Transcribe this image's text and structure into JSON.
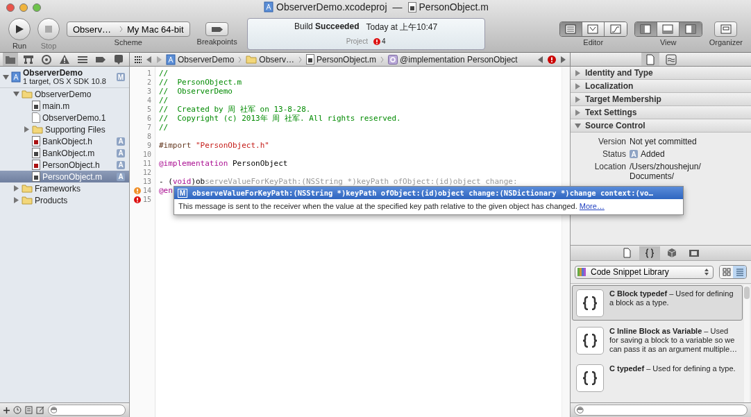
{
  "window": {
    "project_title": "ObserverDemo.xcodeproj",
    "separator": "—",
    "file_title": "PersonObject.m"
  },
  "toolbar": {
    "run": {
      "label": "Run",
      "disabled": false
    },
    "stop": {
      "label": "Stop",
      "disabled": true
    },
    "scheme": {
      "target": "Observ…",
      "destination": "My Mac 64-bit",
      "label": "Scheme"
    },
    "breakpoints": {
      "label": "Breakpoints"
    },
    "activity": {
      "status": "Build **Succeeded**",
      "time": "Today at 上午10:47",
      "scope": "Project",
      "issue_count": "4"
    },
    "editor_modes": {
      "label": "Editor",
      "buttons": [
        {
          "kind": "standard",
          "selected": true
        },
        {
          "kind": "assistant",
          "selected": false
        },
        {
          "kind": "version",
          "selected": false
        }
      ]
    },
    "view_toggles": {
      "label": "View",
      "buttons": [
        {
          "kind": "navigator",
          "on": true
        },
        {
          "kind": "debug",
          "on": false
        },
        {
          "kind": "utilities",
          "on": true
        }
      ]
    },
    "organizer": {
      "label": "Organizer"
    }
  },
  "navigator_tabs": [
    {
      "kind": "project",
      "selected": true
    },
    {
      "kind": "symbol",
      "selected": false
    },
    {
      "kind": "search",
      "selected": false
    },
    {
      "kind": "issue",
      "selected": false
    },
    {
      "kind": "debug",
      "selected": false
    },
    {
      "kind": "breakpoint",
      "selected": false
    },
    {
      "kind": "log",
      "selected": false
    }
  ],
  "jump_bar": {
    "crumbs": [
      {
        "kind": "project",
        "label": "ObserverDemo"
      },
      {
        "kind": "folder",
        "label": "Observ…"
      },
      {
        "kind": "source",
        "label": "PersonObject.m"
      },
      {
        "kind": "class",
        "label": "@implementation PersonObject"
      }
    ]
  },
  "navigator": {
    "project": {
      "name": "ObserverDemo",
      "subtitle": "1 target, OS X SDK 10.8",
      "badge": "M",
      "expanded": true
    },
    "items": [
      {
        "kind": "folder",
        "name": "ObserverDemo",
        "expanded": true,
        "selected": false,
        "children": [
          {
            "kind": "m",
            "name": "main.m",
            "selected": false
          },
          {
            "kind": "doc",
            "name": "ObserverDemo.1",
            "selected": false
          },
          {
            "kind": "folder",
            "name": "Supporting Files",
            "expanded": false,
            "selected": false
          },
          {
            "kind": "h",
            "name": "BankObject.h",
            "badge": "A",
            "selected": false
          },
          {
            "kind": "m",
            "name": "BankObject.m",
            "badge": "A",
            "selected": false
          },
          {
            "kind": "h",
            "name": "PersonObject.h",
            "badge": "A",
            "selected": false
          },
          {
            "kind": "m",
            "name": "PersonObject.m",
            "badge": "A",
            "selected": true
          }
        ]
      },
      {
        "kind": "folder",
        "name": "Frameworks",
        "expanded": false,
        "selected": false
      },
      {
        "kind": "folder",
        "name": "Products",
        "expanded": false,
        "selected": false
      }
    ]
  },
  "code": {
    "lines": [
      {
        "number": "1",
        "segments": [
          {
            "kind": "comment",
            "text": "//"
          }
        ]
      },
      {
        "number": "2",
        "segments": [
          {
            "kind": "comment",
            "text": "//  PersonObject.m"
          }
        ]
      },
      {
        "number": "3",
        "segments": [
          {
            "kind": "comment",
            "text": "//  ObserverDemo"
          }
        ]
      },
      {
        "number": "4",
        "segments": [
          {
            "kind": "comment",
            "text": "//"
          }
        ]
      },
      {
        "number": "5",
        "segments": [
          {
            "kind": "comment",
            "text": "//  Created by 周 社军 on 13-8-28."
          }
        ]
      },
      {
        "number": "6",
        "segments": [
          {
            "kind": "comment",
            "text": "//  Copyright (c) 2013年 周 社军. All rights reserved."
          }
        ]
      },
      {
        "number": "7",
        "segments": [
          {
            "kind": "comment",
            "text": "//"
          }
        ]
      },
      {
        "number": "8"
      },
      {
        "number": "9",
        "segments": [
          {
            "kind": "directive",
            "text": "#import "
          },
          {
            "kind": "string",
            "text": "\"PersonObject.h\""
          }
        ]
      },
      {
        "number": "10"
      },
      {
        "number": "11",
        "segments": [
          {
            "kind": "keyword",
            "text": "@implementation"
          },
          {
            "kind": "plain",
            "text": " PersonObject"
          }
        ]
      },
      {
        "number": "12"
      },
      {
        "number": "13",
        "segments": [
          {
            "kind": "plain",
            "text": "- ("
          },
          {
            "kind": "keyword",
            "text": "void"
          },
          {
            "kind": "plain",
            "text": ")ob"
          },
          {
            "kind": "completion",
            "text": "serveValueForKeyPath:(NSString *)keyPath ofObject:(id)object change:"
          }
        ]
      },
      {
        "number": "14",
        "kind": "warning",
        "segments": [
          {
            "kind": "keyword",
            "text": "@en"
          }
        ]
      },
      {
        "number": "15",
        "kind": "error"
      }
    ]
  },
  "completion": {
    "badge": "M",
    "signature": "observeValueForKeyPath:(NSString *)keyPath ofObject:(id)object change:(NSDictionary *)change context:(vo…",
    "description": "This message is sent to the receiver when the value at the specified key path relative to the given object has changed.",
    "link": "More…"
  },
  "inspector": {
    "tabs": [
      {
        "kind": "file",
        "selected": true
      },
      {
        "kind": "help",
        "selected": false
      }
    ],
    "sections": [
      {
        "title": "Identity and Type",
        "expanded": false
      },
      {
        "title": "Localization",
        "expanded": false
      },
      {
        "title": "Target Membership",
        "expanded": false
      },
      {
        "title": "Text Settings",
        "expanded": false
      },
      {
        "title": "Source Control",
        "expanded": true,
        "fields": [
          {
            "label": "Version",
            "value": "Not yet committed"
          },
          {
            "label": "Status",
            "badge": "A",
            "value": "Added"
          },
          {
            "label": "Location",
            "lines": [
              "/Users/zhoushejun/",
              "Documents/"
            ]
          }
        ]
      }
    ]
  },
  "library": {
    "tabs": [
      {
        "kind": "file",
        "selected": false
      },
      {
        "kind": "snippet",
        "selected": true
      },
      {
        "kind": "object",
        "selected": false
      },
      {
        "kind": "media",
        "selected": false
      }
    ],
    "selector": "Code Snippet Library",
    "view_modes": [
      {
        "kind": "grid",
        "selected": false
      },
      {
        "kind": "list",
        "selected": true
      }
    ],
    "snippets": [
      {
        "text": "**C Block typedef** – Used for defining a block as a type.",
        "selected": true
      },
      {
        "text": "**C Inline Block as Variable** – Used for saving a block to a variable so we can pass it as an argument multiple…",
        "selected": false
      },
      {
        "text": "**C typedef** – Used for defining a type.",
        "selected": false
      }
    ]
  }
}
